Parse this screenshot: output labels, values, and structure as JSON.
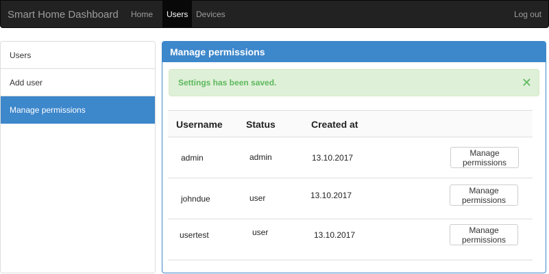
{
  "navbar": {
    "brand": "Smart Home Dashboard",
    "links": [
      {
        "label": "Home"
      },
      {
        "label": "Users",
        "active": true
      },
      {
        "label": "Devices"
      }
    ],
    "logout": "Log out"
  },
  "sidebar": {
    "items": [
      {
        "label": "Users"
      },
      {
        "label": "Add user"
      },
      {
        "label": "Manage permissions",
        "active": true
      }
    ]
  },
  "panel": {
    "title": "Manage permissions",
    "alert": {
      "message": "Settings has been saved.",
      "close_icon": "✕"
    },
    "table": {
      "headers": [
        "Username",
        "Status",
        "Created at"
      ],
      "rows": [
        {
          "username": "admin",
          "status": "admin",
          "created": "13.10.2017",
          "action": "Manage permissions"
        },
        {
          "username": "johndue",
          "status": "user",
          "created": "13.10.2017",
          "action": "Manage permissions"
        },
        {
          "username": "usertest",
          "status": "user",
          "created": "13.10.2017",
          "action": "Manage permissions"
        }
      ]
    }
  },
  "colors": {
    "navbar_bg": "#222222",
    "accent": "#3d87cb",
    "success_bg": "#dff0d8",
    "success_text": "#5cb85c"
  }
}
